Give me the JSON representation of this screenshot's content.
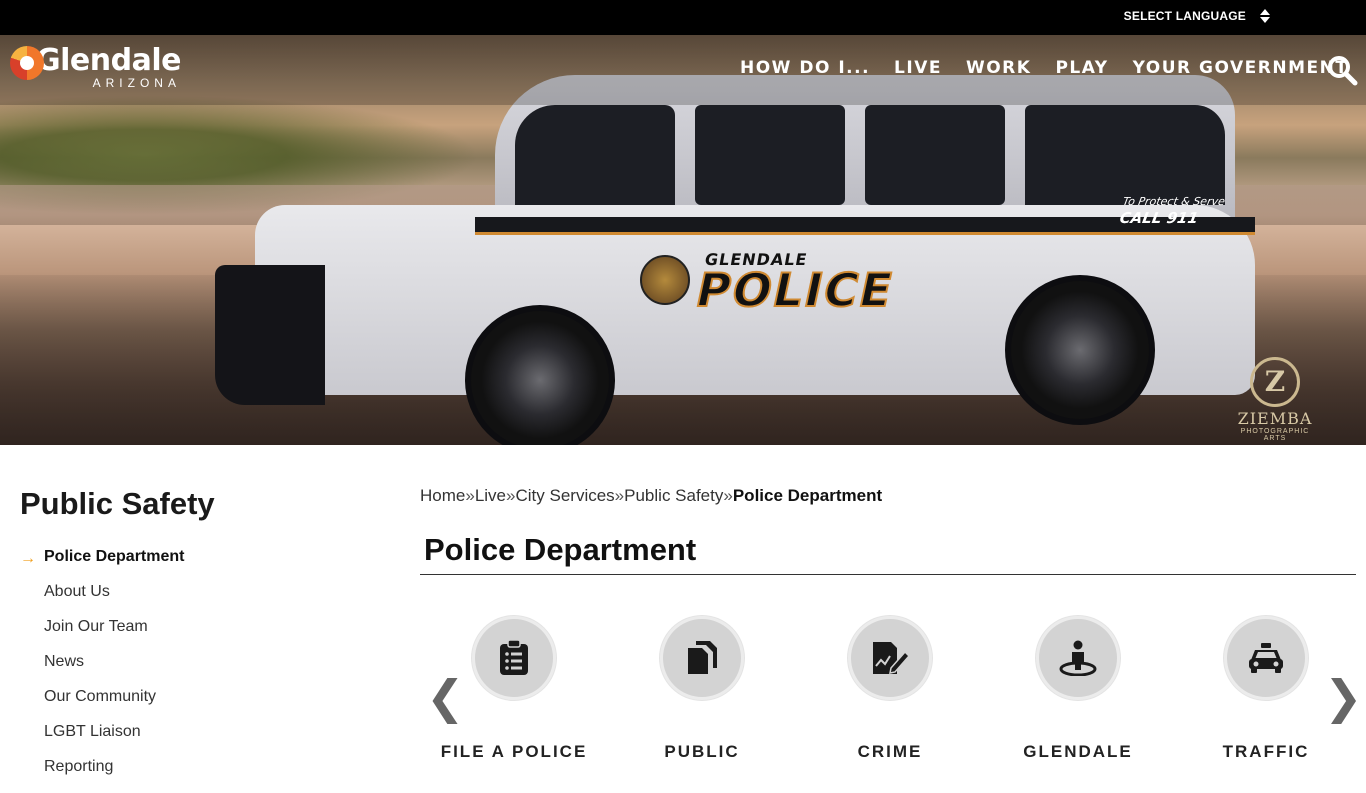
{
  "topbar": {
    "language_label": "SELECT LANGUAGE"
  },
  "logo": {
    "name": "Glendale",
    "sub": "ARIZONA"
  },
  "nav": {
    "items": [
      {
        "label": "HOW DO I..."
      },
      {
        "label": "LIVE"
      },
      {
        "label": "WORK"
      },
      {
        "label": "PLAY"
      },
      {
        "label": "YOUR GOVERNMENT"
      }
    ]
  },
  "hero": {
    "car_brand": "GLENDALE",
    "car_word": "POLICE",
    "slogan_line1": "To Protect & Serve",
    "slogan_line2": "CALL 911",
    "watermark_title": "ZIEMBA",
    "watermark_sub": "PHOTOGRAPHIC ARTS"
  },
  "sidebar": {
    "title": "Public Safety",
    "items": [
      {
        "label": "Police Department"
      },
      {
        "label": "About Us"
      },
      {
        "label": "Join Our Team"
      },
      {
        "label": "News"
      },
      {
        "label": "Our Community"
      },
      {
        "label": "LGBT Liaison"
      },
      {
        "label": "Reporting"
      }
    ]
  },
  "breadcrumb": {
    "items": [
      "Home",
      "Live",
      "City Services",
      "Public Safety",
      "Police Department"
    ],
    "separator": "»"
  },
  "page": {
    "title": "Police Department"
  },
  "tiles": [
    {
      "label": "FILE A POLICE",
      "icon": "clipboard-icon"
    },
    {
      "label": "PUBLIC",
      "icon": "documents-icon"
    },
    {
      "label": "CRIME",
      "icon": "report-edit-icon"
    },
    {
      "label": "GLENDALE",
      "icon": "person-pin-icon"
    },
    {
      "label": "TRAFFIC",
      "icon": "car-icon"
    }
  ],
  "colors": {
    "accent": "#f0a020",
    "topbar": "#000000",
    "tile_bg": "#d3d3d3"
  }
}
